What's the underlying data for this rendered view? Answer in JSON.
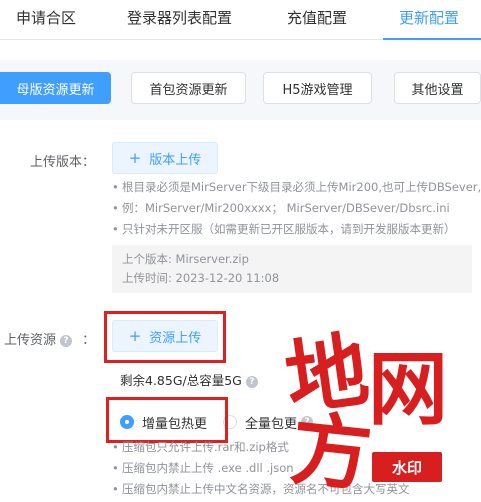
{
  "tabs": [
    {
      "label": "申请合区",
      "active": false
    },
    {
      "label": "登录器列表配置",
      "active": false
    },
    {
      "label": "充值配置",
      "active": false
    },
    {
      "label": "更新配置",
      "active": true
    }
  ],
  "subtabs": [
    {
      "label": "母版资源更新",
      "active": true
    },
    {
      "label": "首包资源更新",
      "active": false
    },
    {
      "label": "H5游戏管理",
      "active": false
    },
    {
      "label": "其他设置",
      "active": false
    }
  ],
  "version": {
    "label": "上传版本：",
    "button": "版本上传",
    "tips": [
      "根目录必须是MirServer下级目录必须上传Mir200,也可上传DBSever,",
      "例：MirServer/Mir200xxxx； MirServer/DBSever/Dbsrc.ini",
      "只针对未开区服（如需更新已开区服版本，请到开发服版本更新）"
    ],
    "last_version": "上个版本: Mirserver.zip",
    "upload_time": "上传时间: 2023-12-20 11:08"
  },
  "resource": {
    "label": "上传资源",
    "colon": "：",
    "button": "资源上传",
    "quota": "剩余4.85G/总容量5G",
    "radio_incremental": "增量包热更",
    "radio_full": "全量包更",
    "tips": [
      "压缩包只允许上传.rar和.zip格式",
      "压缩包内禁止上传 .exe .dll .json",
      "压缩包内禁止上传中文名资源，资源名不可包含大写英文"
    ]
  },
  "watermark": {
    "chars": [
      "地",
      "网",
      "方"
    ],
    "badge": "水印"
  },
  "colors": {
    "accent": "#409eff",
    "highlight": "#e02020"
  }
}
